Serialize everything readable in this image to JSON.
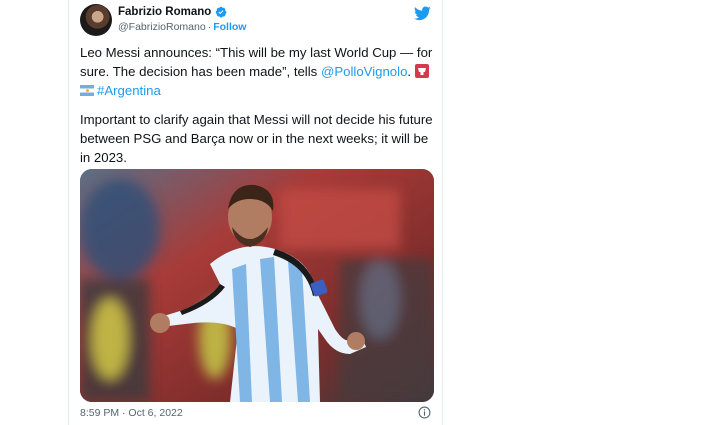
{
  "tweet": {
    "author": {
      "name": "Fabrizio Romano",
      "handle": "@FabrizioRomano",
      "separator": "·",
      "follow_label": "Follow",
      "verified_icon": "verified-badge-icon"
    },
    "logo_icon": "twitter-bird-icon",
    "text": {
      "p1_before": "Leo Messi announces: “This will be my last World Cup — for sure. The decision has been made”, tells ",
      "mention": "@PolloVignolo",
      "p1_after": ". ",
      "hashtag": "#Argentina",
      "p2": "Important to clarify again that Messi will not decide his future between PSG and Barça now or in the next weeks; it will be in 2023."
    },
    "media": {
      "subject": "messi-argentina-celebration-photo"
    },
    "timestamp": "8:59 PM · Oct 6, 2022",
    "info_icon": "info-icon"
  },
  "colors": {
    "link": "#1d9bf0",
    "text": "#0f1419",
    "muted": "#536471"
  }
}
